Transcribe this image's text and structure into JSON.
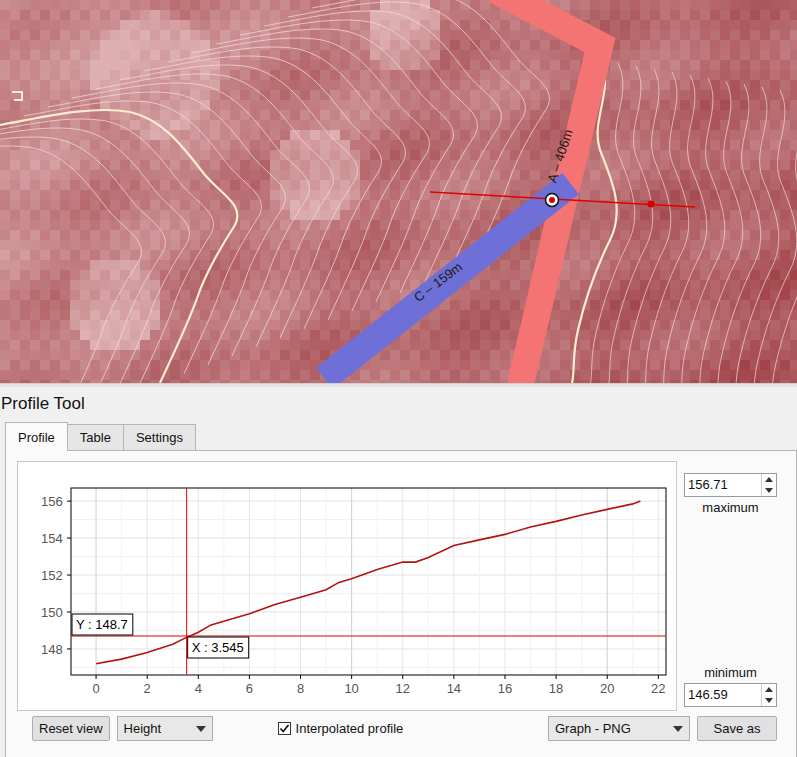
{
  "map": {
    "labels": [
      {
        "text": "A – 406m",
        "color": "#f47373"
      },
      {
        "text": "C – 159m",
        "color": "#6e70d8"
      }
    ]
  },
  "panel": {
    "title": "Profile Tool"
  },
  "tabs": [
    {
      "label": "Profile",
      "selected": true
    },
    {
      "label": "Table",
      "selected": false
    },
    {
      "label": "Settings",
      "selected": false
    }
  ],
  "chart": {
    "y_ticks": [
      "148",
      "150",
      "152",
      "154",
      "156"
    ],
    "x_ticks": [
      "0",
      "2",
      "4",
      "6",
      "8",
      "10",
      "12",
      "14",
      "16",
      "18",
      "20",
      "22"
    ],
    "series": [
      {
        "x": [
          0,
          1,
          2,
          3,
          3.5,
          4,
          4.5,
          5,
          6,
          7,
          8,
          9,
          9.5,
          10,
          11,
          12,
          12.5,
          13,
          14,
          15,
          16,
          17,
          18,
          19,
          20,
          21,
          21.3
        ],
        "y": [
          147.2,
          147.45,
          147.8,
          148.25,
          148.6,
          148.9,
          149.3,
          149.5,
          149.9,
          150.4,
          150.8,
          151.2,
          151.6,
          151.8,
          152.3,
          152.7,
          152.7,
          152.95,
          153.6,
          153.9,
          154.2,
          154.6,
          154.9,
          155.25,
          155.55,
          155.85,
          156.0
        ]
      }
    ],
    "cursor": {
      "x": 3.545,
      "y": 148.7,
      "x_label": "X : 3.545",
      "y_label": "Y : 148.7"
    }
  },
  "range": {
    "maximum": "156.71",
    "maximum_label": "maximum",
    "minimum": "146.59",
    "minimum_label": "minimum"
  },
  "controls": {
    "reset_button": "Reset view",
    "mode": "Height",
    "interpolated": {
      "label": "Interpolated profile",
      "checked": true
    },
    "export_format": "Graph - PNG",
    "save_button": "Save as"
  }
}
